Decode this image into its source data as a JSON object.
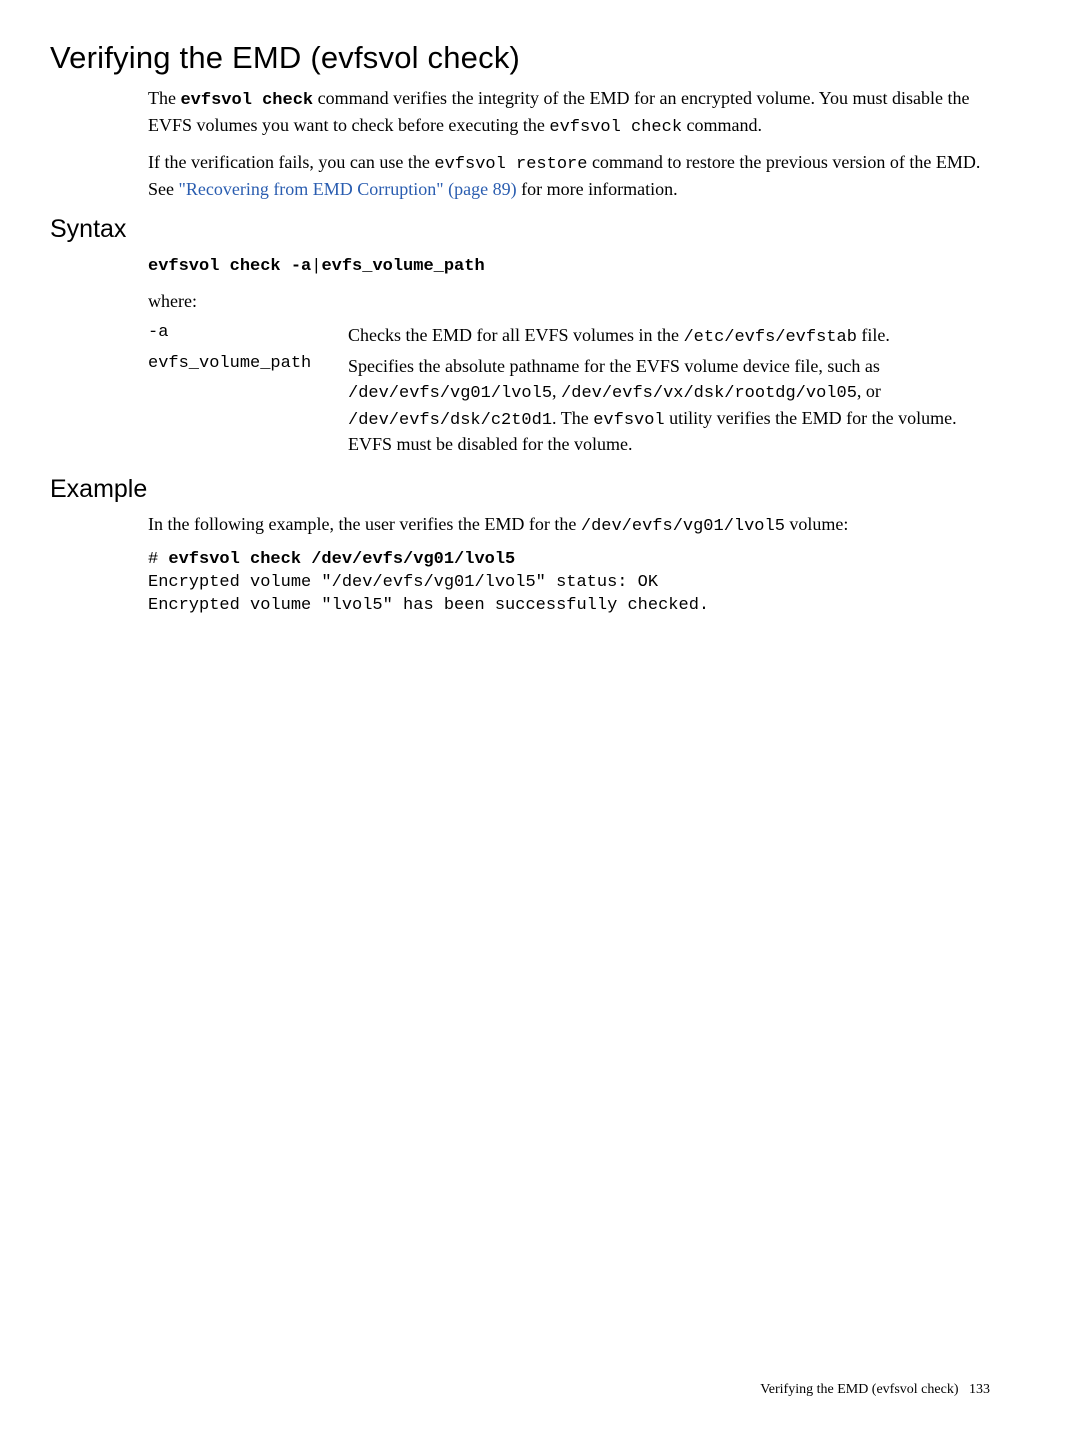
{
  "title": "Verifying the EMD (evfsvol check)",
  "intro": {
    "p1_parts": {
      "t1": "The ",
      "cmd": "evfsvol check",
      "t2": " command verifies the integrity of the EMD for an encrypted volume. You must disable the EVFS volumes you want to check before executing the ",
      "mono": "evfsvol check",
      "t3": " command."
    },
    "p2_parts": {
      "t1": "If the verification fails, you can use the ",
      "mono": "evfsvol restore",
      "t2": " command to restore the previous version of the EMD. See ",
      "link": "\"Recovering from EMD Corruption\" (page 89)",
      "t3": " for more information."
    }
  },
  "syntax": {
    "heading": "Syntax",
    "cmd_parts": {
      "c1": "evfsvol check -a",
      "bar": "|",
      "c2": "evfs_volume_path"
    },
    "where": "where:",
    "defs": {
      "a_term": "-a",
      "a_desc": {
        "t1": "Checks the EMD for all EVFS volumes in the ",
        "mono": "/etc/evfs/evfstab",
        "t2": " file."
      },
      "path_term": "evfs_volume_path",
      "path_desc": {
        "t1": "Specifies the absolute pathname for the EVFS volume device file, such as ",
        "m1": "/dev/evfs/vg01/lvol5",
        "t2": ", ",
        "m2": "/dev/evfs/vx/dsk/rootdg/vol05",
        "t3": ", or ",
        "m3": "/dev/evfs/dsk/c2t0d1",
        "t4": ". The ",
        "m4": "evfsvol",
        "t5": " utility verifies the EMD for the volume. EVFS must be disabled for the volume."
      }
    }
  },
  "example": {
    "heading": "Example",
    "intro": {
      "t1": "In the following example, the user verifies the EMD for the ",
      "mono": "/dev/evfs/vg01/lvol5",
      "t2": " volume:"
    },
    "code": {
      "prompt": "# ",
      "cmd": "evfsvol check /dev/evfs/vg01/lvol5",
      "out1": "Encrypted volume \"/dev/evfs/vg01/lvol5\" status: OK",
      "out2": "Encrypted volume \"lvol5\" has been successfully checked."
    }
  },
  "footer": {
    "text": "Verifying the EMD (evfsvol check)",
    "page": "133"
  }
}
